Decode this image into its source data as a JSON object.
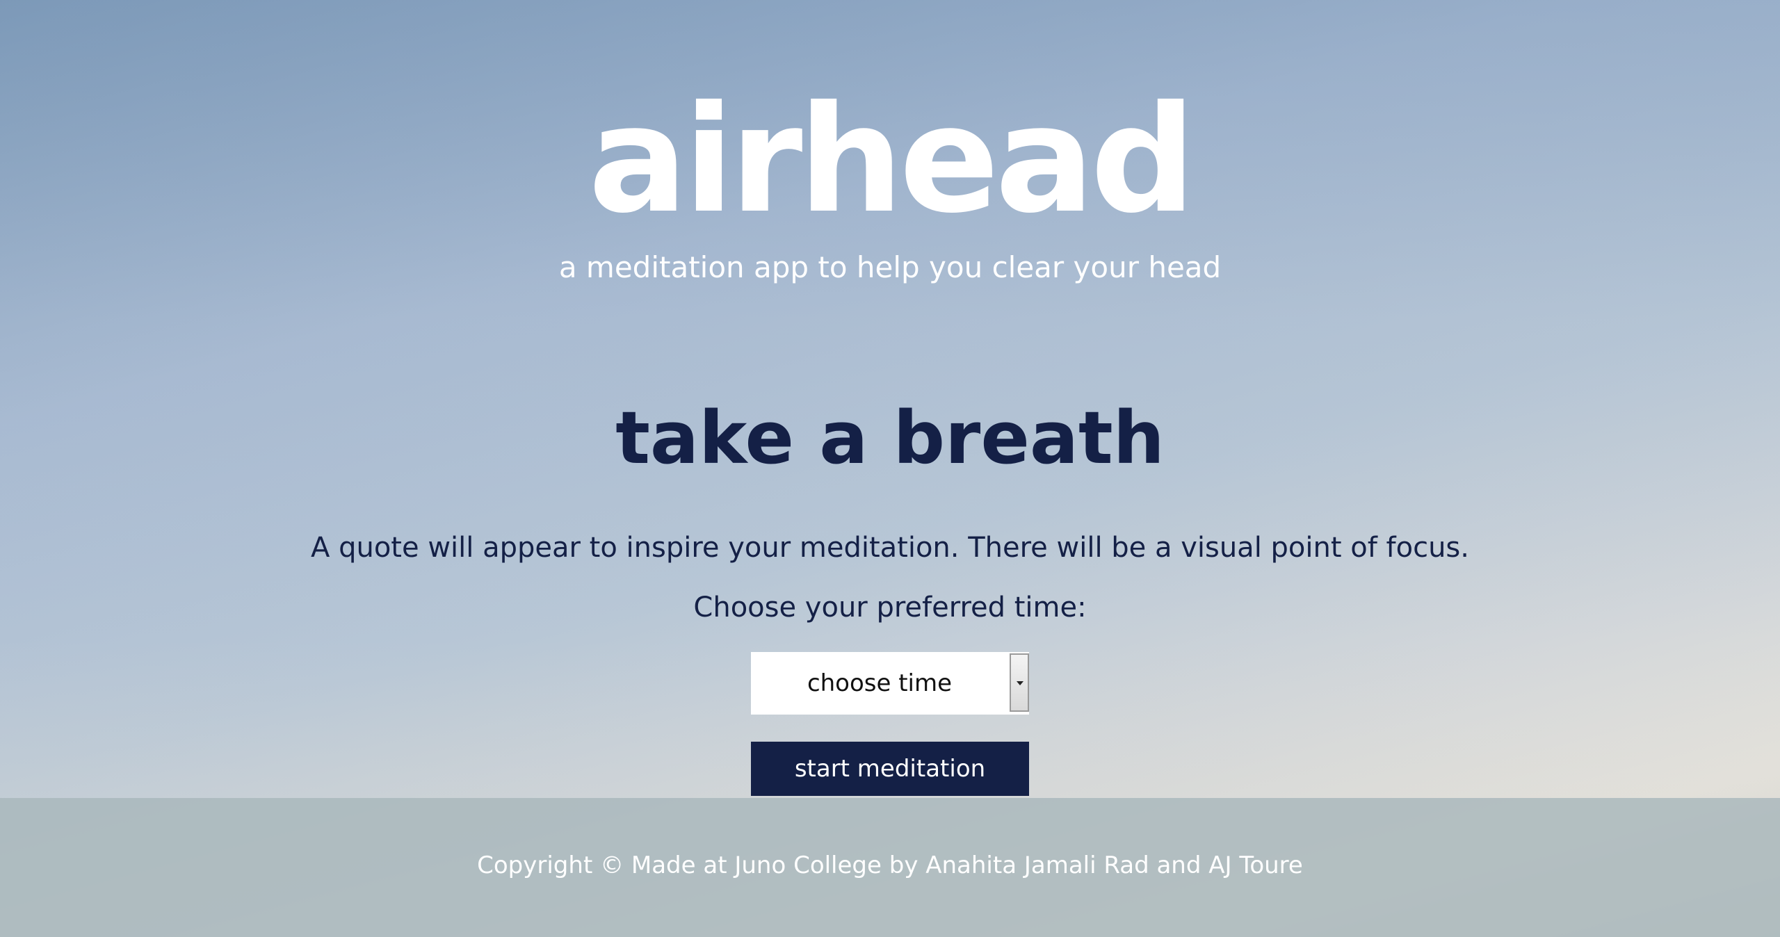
{
  "header": {
    "title": "airhead",
    "subtitle": "a meditation app to help you clear your head"
  },
  "main": {
    "heading": "take a breath",
    "description": "A quote will appear to inspire your meditation. There will be a visual point of focus.",
    "time_prompt": "Choose your preferred time:",
    "time_select": {
      "selected": "choose time"
    },
    "start_button_label": "start meditation"
  },
  "footer": {
    "copyright": "Copyright © Made at Juno College by Anahita Jamali Rad and AJ Toure"
  },
  "colors": {
    "navy": "#142046",
    "white": "#ffffff"
  }
}
